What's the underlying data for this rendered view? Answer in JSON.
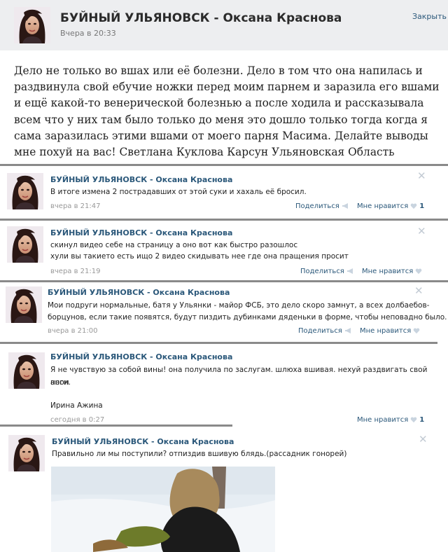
{
  "post": {
    "title": "БУЙНЫЙ УЛЬЯНОВСК - Оксана Краснова",
    "time": "Вчера в 20:33",
    "close": "Закрыть",
    "text": "Дело не только во вшах или её болезни. Дело в том что она напилась и раздвинула свой ебучие ножки перед моим парнем и заразила его вшами и ещё какой-то венерической болезнью а после ходила и рассказывала всем что у них там было только до меня это дошло только тогда когда я сама заразилась этими вшами от моего парня Масима. Делайте выводы мне похуй на вас! Светлана Куклова Карсун Ульяновская Область"
  },
  "comments": [
    {
      "name": "БУЙНЫЙ УЛЬЯНОВСК - Оксана Краснова",
      "lines": [
        "В итоге измена 2 пострадавших от этой суки и хахаль её бросил."
      ],
      "time": "вчера в 21:47",
      "share": "Поделиться",
      "like": "Мне нравится",
      "likes": "1"
    },
    {
      "name": "БУЙНЫЙ УЛЬЯНОВСК - Оксана Краснова",
      "lines": [
        "скинул видео себе на страницу а оно вот как быстро разошлос",
        "хули вы такието есть ищо 2 видео скидывать нее где она пращения просит"
      ],
      "time": "вчера в 21:19",
      "share": "Поделиться",
      "like": "Мне нравится",
      "likes": ""
    },
    {
      "name": "БУЙНЫЙ УЛЬЯНОВСК - Оксана Краснова",
      "lines": [
        "Мои подруги нормальные, батя у Ульянки - майор ФСБ, это дело скоро замнут, а всех долбаебов-",
        "борцунов, если такие появятся, будут пиздить дубинками дяденьки в форме, чтобы неповадно было."
      ],
      "time": "вчера в 21:00",
      "share": "Поделиться",
      "like": "Мне нравится",
      "likes": ""
    },
    {
      "name": "БУЙНЫЙ УЛЬЯНОВСК - Оксана Краснова",
      "lines": [
        "Я не чувствую за собой вины! она получила по заслугам. шлюха вшивая. нехуй раздвигать свой ноги.",
        "анон",
        "",
        "Ирина Ажина"
      ],
      "time": "сегодня в 0:27",
      "share": "",
      "like": "Мне нравится",
      "likes": "1"
    },
    {
      "name": "БУЙНЫЙ УЛЬЯНОВСК - Оксана Краснова",
      "lines": [
        "Правильно ли мы поступили? отпиздив вшивую блядь.(рассадник гонорей)"
      ],
      "time": "",
      "share": "",
      "like": "",
      "likes": ""
    }
  ],
  "colors": {
    "link": "#2b587a",
    "header_bg": "#edeef0",
    "separator": "#8a8a8a"
  },
  "icons": {
    "close": "close-icon",
    "share": "megaphone-icon",
    "like": "heart-icon"
  }
}
